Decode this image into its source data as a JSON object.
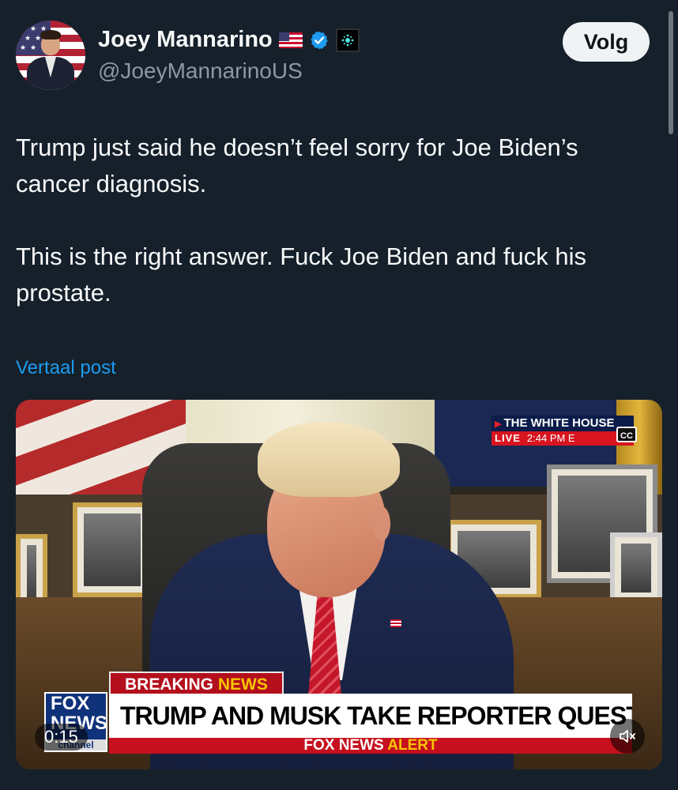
{
  "author": {
    "name": "Joey Mannarino",
    "handle": "@JoeyMannarinoUS",
    "flag_icon": "us-flag-emoji",
    "verified_icon": "verified-badge-icon",
    "affiliation_icon": "affiliate-badge-icon"
  },
  "follow_button": {
    "label": "Volg"
  },
  "post": {
    "paragraphs": [
      "Trump just said he doesn’t feel sorry for Joe Biden’s cancer diagnosis.",
      "This is the right answer. Fuck Joe Biden and fuck his prostate."
    ],
    "translate_label": "Vertaal post"
  },
  "video": {
    "timestamp": "0:15",
    "bug": {
      "source": "THE WHITE HOUSE",
      "live": "LIVE",
      "time": "2:44 PM E",
      "cc": "CC"
    },
    "lower_third": {
      "breaking_1": "BREAKING ",
      "breaking_2": "NEWS",
      "headline": "TRUMP AND MUSK TAKE REPORTER QUESTIONS",
      "alert_1": "FOX NEWS ",
      "alert_2": "ALERT"
    },
    "logo": {
      "line1": "FOX",
      "line2": "NEWS",
      "line3": "channel"
    }
  },
  "colors": {
    "background": "#15202b",
    "text": "#f7f9f9",
    "secondary_text": "#8b98a5",
    "link": "#1d9bf0",
    "verified": "#1d9bf0"
  }
}
